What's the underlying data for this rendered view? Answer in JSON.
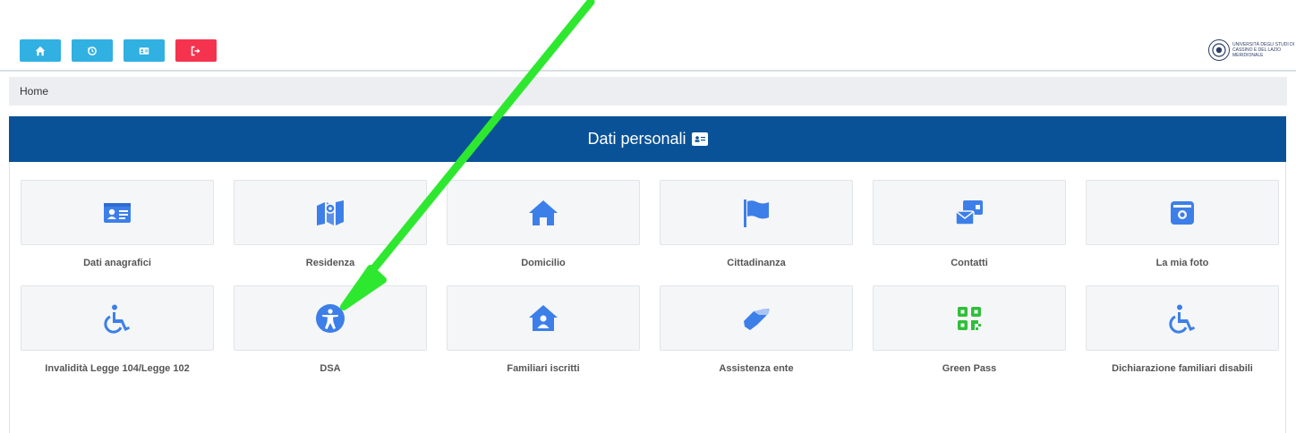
{
  "toolbar": {
    "buttons": [
      {
        "name": "home",
        "icon": "home-icon"
      },
      {
        "name": "history",
        "icon": "history-icon"
      },
      {
        "name": "id-card",
        "icon": "id-card-icon"
      },
      {
        "name": "logout",
        "icon": "logout-icon"
      }
    ]
  },
  "logo": {
    "text": "UNIVERSITÀ DEGLI STUDI DI CASSINO E DEL LAZIO MERIDIONALE"
  },
  "breadcrumb": {
    "home": "Home"
  },
  "panel": {
    "title": "Dati personali",
    "title_icon": "id-card-icon",
    "header_color": "#0a5297"
  },
  "items": [
    {
      "label": "Dati anagrafici",
      "icon": "id-card-icon",
      "color": "#3d7fe8"
    },
    {
      "label": "Residenza",
      "icon": "map-icon",
      "color": "#3d7fe8"
    },
    {
      "label": "Domicilio",
      "icon": "house-icon",
      "color": "#3d7fe8"
    },
    {
      "label": "Cittadinanza",
      "icon": "flag-icon",
      "color": "#3d7fe8"
    },
    {
      "label": "Contatti",
      "icon": "contacts-icon",
      "color": "#3d7fe8"
    },
    {
      "label": "La mia foto",
      "icon": "camera-icon",
      "color": "#3d7fe8"
    },
    {
      "label": "Invalidità Legge 104/Legge 102",
      "icon": "wheelchair-icon",
      "color": "#3d7fe8"
    },
    {
      "label": "DSA",
      "icon": "accessibility-icon",
      "color": "#3d7fe8"
    },
    {
      "label": "Familiari iscritti",
      "icon": "house-user-icon",
      "color": "#3d7fe8"
    },
    {
      "label": "Assistenza ente",
      "icon": "handshake-icon",
      "color": "#3d7fe8"
    },
    {
      "label": "Green Pass",
      "icon": "qrcode-icon",
      "color": "#2fbf3a"
    },
    {
      "label": "Dichiarazione familiari disabili",
      "icon": "wheelchair-icon",
      "color": "#3d7fe8"
    }
  ],
  "annotation": {
    "arrow_color": "#2ee830"
  }
}
